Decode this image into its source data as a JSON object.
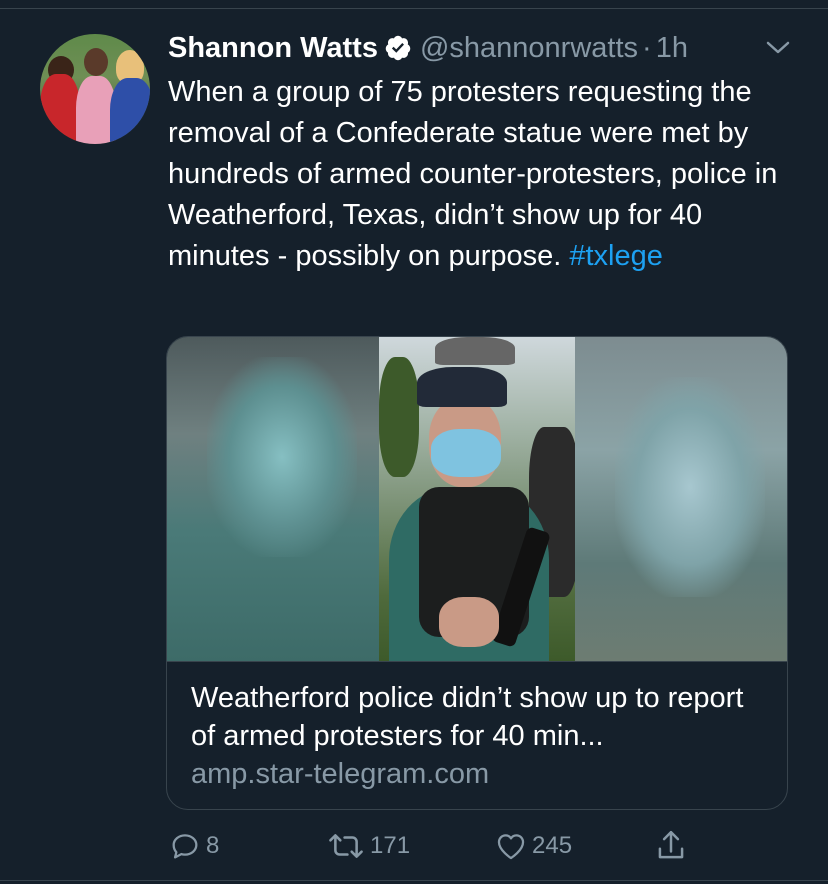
{
  "tweet": {
    "author_name": "Shannon Watts",
    "handle": "@shannonrwatts",
    "separator": "·",
    "time": "1h",
    "text_main": "When a group of 75 protesters requesting the removal of a Confederate statue were met by hundreds of armed counter-protesters, police in Weatherford, Texas, didn’t show up for 40 minutes - possibly on purpose.",
    "hashtag": "#txlege"
  },
  "card": {
    "title": "Weatherford police didn’t show up to report of armed protesters for 40 min...",
    "domain": "amp.star-telegram.com"
  },
  "actions": {
    "replies": "8",
    "retweets": "171",
    "likes": "245"
  },
  "colors": {
    "background": "#15202b",
    "text": "#ffffff",
    "secondary": "#8899a6",
    "accent": "#1da1f2",
    "border": "#38444d"
  },
  "icons": [
    "verified-badge-icon",
    "chevron-down-icon",
    "reply-icon",
    "retweet-icon",
    "like-icon",
    "share-icon"
  ]
}
